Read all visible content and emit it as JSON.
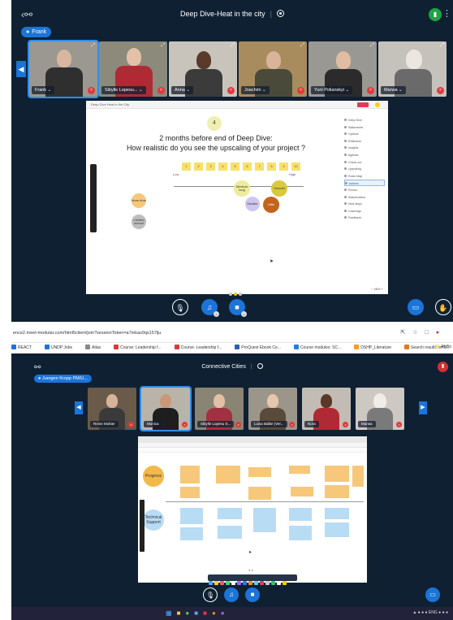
{
  "top": {
    "title": "Deep Dive-Heat in the city",
    "speaker_pill": "Frank",
    "participants": [
      {
        "name": "Frank",
        "active": true
      },
      {
        "name": "Sibylle Lopesu..."
      },
      {
        "name": "Anna"
      },
      {
        "name": "Joachim"
      },
      {
        "name": "Yurii Polianskyi"
      },
      {
        "name": "Marwa"
      }
    ],
    "board": {
      "tab_title": "Deep Dive Heat in the City",
      "step_number": "4",
      "question_line1": "2 months before end of Deep Dive:",
      "question_line2": "How realistic do you see the upscaling of your project ?",
      "scale": [
        "1",
        "2",
        "3",
        "4",
        "5",
        "6",
        "7",
        "8",
        "9",
        "10"
      ],
      "scale_low": "Low",
      "scale_high": "High",
      "circles": [
        {
          "label": "Medium long"
        },
        {
          "label": "Smooth"
        },
        {
          "label": "Smaller"
        },
        {
          "label": "Little"
        },
        {
          "label": "More time"
        },
        {
          "label": "Limited school"
        }
      ],
      "panel_items": [
        "Deep Dive",
        "Statements",
        "Options",
        "Reflection",
        "Insights",
        "Agenda",
        "Check-out",
        "Upscaling",
        "Roles Map",
        "Actions",
        "Round",
        "Stakeholders",
        "Next steps",
        "Learnings",
        "Feedback"
      ],
      "zoom": "48%"
    }
  },
  "bottom": {
    "url": "ence2.meet-modular.com/html5client/join?sessionToken=a7mkas9qs157lju",
    "bookmarks": [
      "REACT",
      "UNDP Jobs",
      "Atlas",
      "Course: Leadership f...",
      "Course: Leadership f...",
      "ProQuest Ebook Ce...",
      "Course modules: SC...",
      "DSHP_Literature",
      "Search results for 0i..."
    ],
    "all_bookmarks": "All Bo",
    "title": "Connective Cities",
    "speaker_pill": "Juergen Kropp PM/U...",
    "participants": [
      {
        "name": "Reine Mokter"
      },
      {
        "name": "Monica"
      },
      {
        "name": "Sibylle Lopesu S..."
      },
      {
        "name": "Luisa Balbe (Ver..."
      },
      {
        "name": "Nora"
      },
      {
        "name": "Marwa"
      }
    ],
    "board": {
      "row1_label": "Progress",
      "row2_label": "Technical Support"
    },
    "tray": "ENG"
  },
  "colors": {
    "frame_bg": "#0f2033",
    "accent_blue": "#1b74d8",
    "mute_red": "#e0393e",
    "sticky_yellow": "#f7e16a",
    "sticky_orange": "#f7c87a",
    "sticky_blue": "#b9dcf5"
  },
  "icons": {
    "users": "users-icon",
    "record": "record-icon",
    "stats": "connection-stats-icon",
    "menu": "more-options-icon",
    "mic_muted": "mic-off-icon",
    "audio": "headphones-icon",
    "camera": "camera-icon",
    "screenshare": "screen-share-icon",
    "hand": "raise-hand-icon"
  }
}
